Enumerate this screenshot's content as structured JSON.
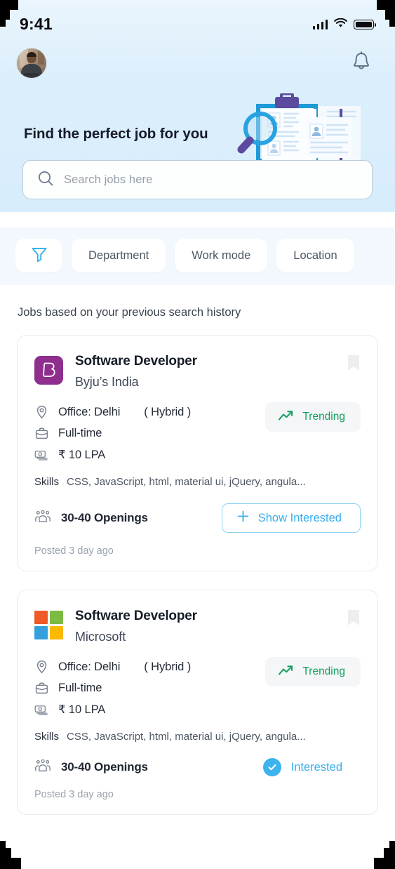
{
  "status_bar": {
    "time": "9:41",
    "signal_icon": "cellular-signal-icon",
    "wifi_icon": "wifi-icon",
    "battery_icon": "battery-icon"
  },
  "header": {
    "avatar_label": "profile-avatar",
    "notification_icon": "bell-icon",
    "title": "Find the perfect job for you",
    "illustration": "job-search-clipboard-illustration"
  },
  "search": {
    "placeholder": "Search jobs here",
    "value": "",
    "icon": "search-icon"
  },
  "filters": {
    "filter_icon": "funnel-filter-icon",
    "chips": [
      {
        "label": "Department"
      },
      {
        "label": "Work mode"
      },
      {
        "label": "Location"
      }
    ]
  },
  "section": {
    "title": "Jobs based on your previous search history"
  },
  "jobs": [
    {
      "title": "Software Developer",
      "company": "Byju’s India",
      "logo": "byjus-logo",
      "logo_color": "#8e2f8e",
      "bookmark_icon": "bookmark-icon",
      "location": "Office: Delhi",
      "work_mode": "( Hybrid )",
      "employment_type": "Full-time",
      "salary": "₹ 10 LPA",
      "badge": {
        "label": "Trending",
        "icon": "trending-up-icon",
        "color": "#14a05e"
      },
      "skills_label": "Skills",
      "skills": "CSS,  JavaScript,  html,  material ui,  jQuery,  angula...",
      "openings": "30-40 Openings",
      "action": {
        "type": "button",
        "label": "Show Interested",
        "icon": "plus-icon",
        "color": "#39aeeb"
      },
      "posted": "Posted 3 day ago"
    },
    {
      "title": "Software Developer",
      "company": "Microsoft",
      "logo": "microsoft-logo",
      "logo_colors": [
        "#f05a28",
        "#7cbb42",
        "#34a0dd",
        "#fbb900"
      ],
      "bookmark_icon": "bookmark-icon",
      "location": "Office: Delhi",
      "work_mode": "( Hybrid )",
      "employment_type": "Full-time",
      "salary": "₹ 10 LPA",
      "badge": {
        "label": "Trending",
        "icon": "trending-up-icon",
        "color": "#14a05e"
      },
      "skills_label": "Skills",
      "skills": "CSS,  JavaScript,  html,  material ui,  jQuery,  angula...",
      "openings": "30-40 Openings",
      "action": {
        "type": "state",
        "label": "Interested",
        "icon": "check-circle-icon",
        "color": "#3cb3ef"
      },
      "posted": "Posted 3 day ago"
    }
  ],
  "theme": {
    "hero_bg": "#dbeefc",
    "filter_bg": "#f2f8fd",
    "accent_blue": "#39aeeb",
    "green": "#14a05e",
    "card_border": "#e8ebef"
  }
}
